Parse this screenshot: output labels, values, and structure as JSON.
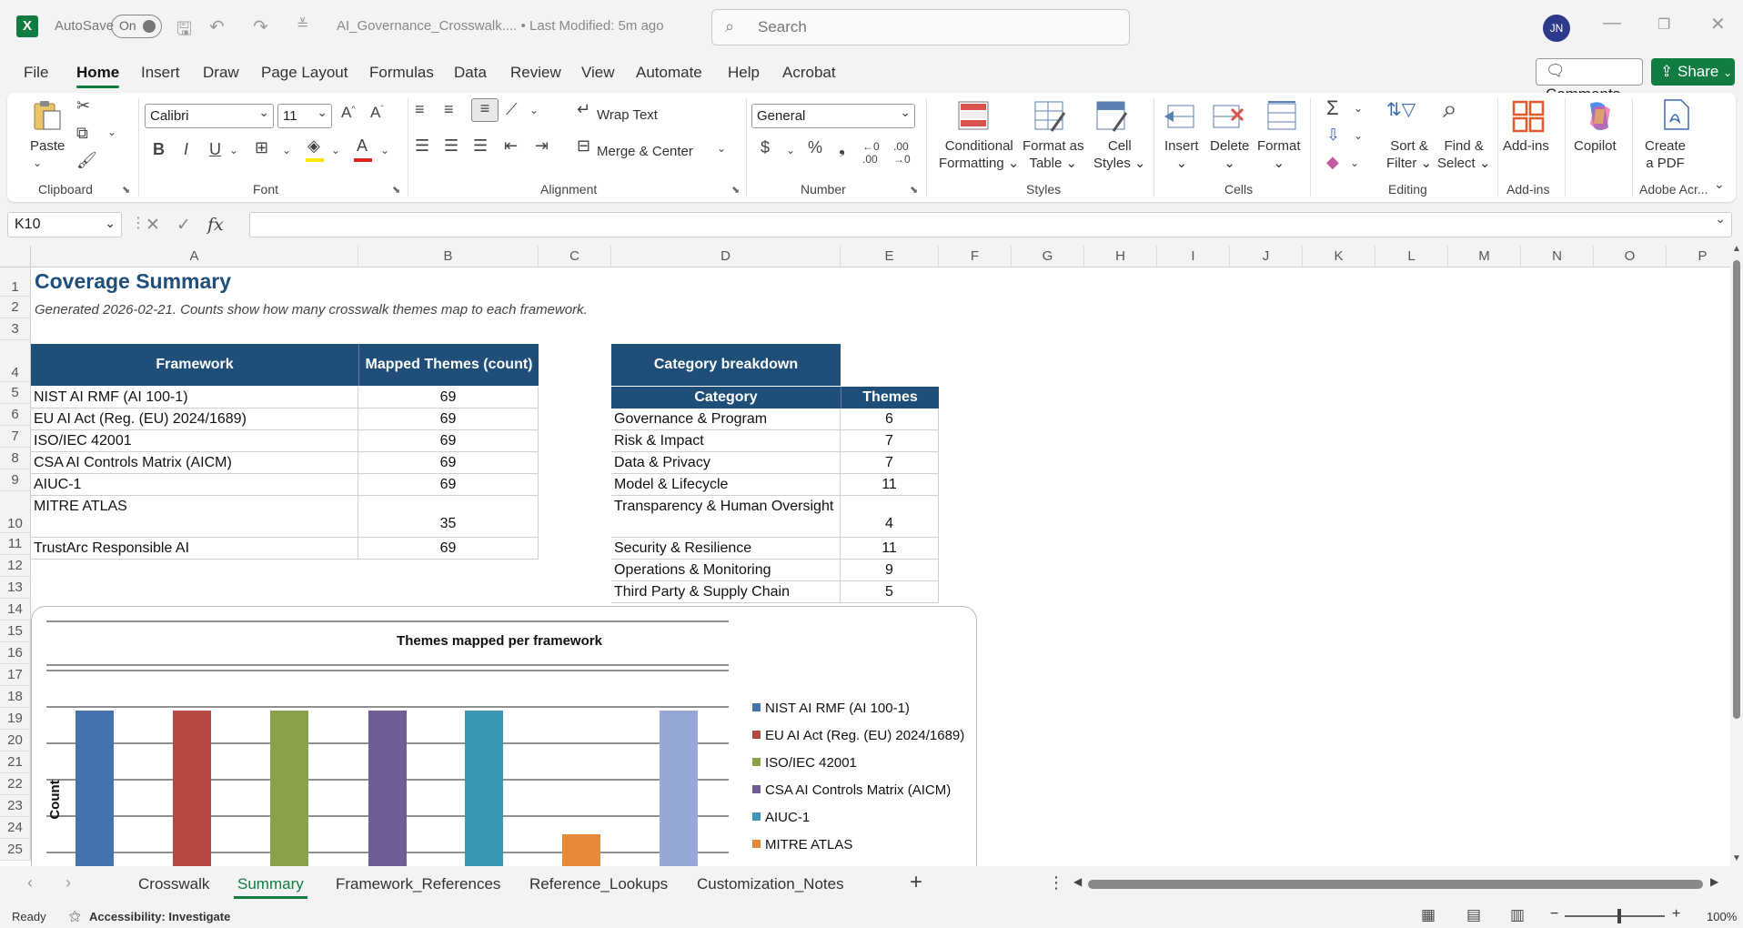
{
  "titlebar": {
    "autosave_label": "AutoSave",
    "autosave_state": "On",
    "doc_title": "AI_Governance_Crosswalk....  •  Last Modified: 5m ago",
    "search_placeholder": "Search",
    "avatar_initials": "JN"
  },
  "menu": {
    "tabs": [
      "File",
      "Home",
      "Insert",
      "Draw",
      "Page Layout",
      "Formulas",
      "Data",
      "Review",
      "View",
      "Automate",
      "Help",
      "Acrobat"
    ],
    "active": "Home",
    "comments_label": "Comments",
    "share_label": "Share"
  },
  "ribbon": {
    "clipboard": {
      "paste": "Paste",
      "label": "Clipboard"
    },
    "font": {
      "family": "Calibri",
      "size": "11",
      "label": "Font"
    },
    "alignment": {
      "wrap_text": "Wrap Text",
      "merge_center": "Merge & Center",
      "label": "Alignment"
    },
    "number": {
      "format": "General",
      "label": "Number"
    },
    "styles": {
      "conditional_1": "Conditional",
      "conditional_2": "Formatting",
      "format_table_1": "Format as",
      "format_table_2": "Table",
      "cell_styles_1": "Cell",
      "cell_styles_2": "Styles",
      "label": "Styles"
    },
    "cells": {
      "insert": "Insert",
      "delete": "Delete",
      "format": "Format",
      "label": "Cells"
    },
    "editing": {
      "sort_1": "Sort &",
      "sort_2": "Filter",
      "find_1": "Find &",
      "find_2": "Select",
      "label": "Editing"
    },
    "addins": {
      "addins": "Add-ins",
      "label": "Add-ins"
    },
    "copilot": {
      "label": "Copilot"
    },
    "acrobat": {
      "create_1": "Create",
      "create_2": "a PDF",
      "label": "Adobe Acr..."
    }
  },
  "formula_bar": {
    "name_box": "K10",
    "fx": "fx",
    "formula": ""
  },
  "columns": [
    "A",
    "B",
    "C",
    "D",
    "E",
    "F",
    "G",
    "H",
    "I",
    "J",
    "K",
    "L",
    "M",
    "N",
    "O",
    "P"
  ],
  "rows": [
    "1",
    "2",
    "3",
    "4",
    "5",
    "6",
    "7",
    "8",
    "9",
    "10",
    "11",
    "12",
    "13",
    "14",
    "15",
    "16",
    "17",
    "18",
    "19",
    "20",
    "21",
    "22",
    "23",
    "24",
    "25"
  ],
  "sheet": {
    "title": "Coverage Summary",
    "subtitle": "Generated 2026-02-21. Counts show how many crosswalk themes map to each framework.",
    "framework_table": {
      "headers": [
        "Framework",
        "Mapped Themes (count)"
      ],
      "rows": [
        [
          "NIST AI RMF (AI 100-1)",
          "69"
        ],
        [
          "EU AI Act (Reg. (EU) 2024/1689)",
          "69"
        ],
        [
          "ISO/IEC 42001",
          "69"
        ],
        [
          "CSA AI Controls Matrix (AICM)",
          "69"
        ],
        [
          "AIUC-1",
          "69"
        ],
        [
          "MITRE ATLAS",
          "35"
        ],
        [
          "TrustArc Responsible AI",
          "69"
        ]
      ]
    },
    "category_table": {
      "title": "Category breakdown",
      "headers": [
        "Category",
        "Themes"
      ],
      "rows": [
        [
          "Governance & Program",
          "6"
        ],
        [
          "Risk & Impact",
          "7"
        ],
        [
          "Data & Privacy",
          "7"
        ],
        [
          "Model & Lifecycle",
          "11"
        ],
        [
          "Transparency & Human Oversight",
          "4"
        ],
        [
          "Security & Resilience",
          "11"
        ],
        [
          "Operations & Monitoring",
          "9"
        ],
        [
          "Third Party & Supply Chain",
          "5"
        ]
      ]
    }
  },
  "chart_data": {
    "type": "bar",
    "title": "Themes mapped per framework",
    "ylabel": "Count",
    "xlabel": "",
    "categories": [
      "NIST AI RMF (AI 100-1)",
      "EU AI Act (Reg. (EU) 2024/1689)",
      "ISO/IEC 42001",
      "CSA AI Controls Matrix (AICM)",
      "AIUC-1",
      "MITRE ATLAS",
      "TrustArc Responsible AI"
    ],
    "values": [
      69,
      69,
      69,
      69,
      69,
      35,
      69
    ],
    "colors": [
      "#4672b0",
      "#b64a43",
      "#8aa049",
      "#715d96",
      "#3b97b4",
      "#e68a3a",
      "#96a9d6"
    ],
    "legend": [
      "NIST AI RMF (AI 100-1)",
      "EU AI Act (Reg. (EU) 2024/1689)",
      "ISO/IEC 42001",
      "CSA AI Controls Matrix (AICM)",
      "AIUC-1",
      "MITRE ATLAS"
    ],
    "legend_position": "right",
    "grid": true,
    "ylim": [
      0,
      80
    ]
  },
  "sheet_tabs": {
    "tabs": [
      "Crosswalk",
      "Summary",
      "Framework_References",
      "Reference_Lookups",
      "Customization_Notes"
    ],
    "active": "Summary"
  },
  "status": {
    "ready": "Ready",
    "accessibility": "Accessibility: Investigate",
    "zoom": "100%"
  }
}
